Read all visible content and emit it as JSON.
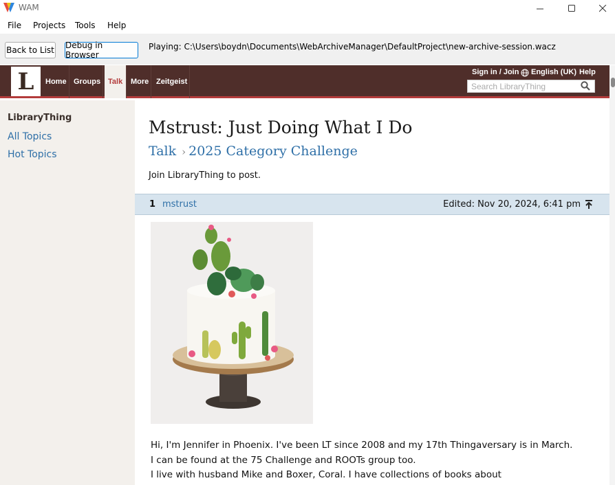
{
  "window": {
    "title": "WAM",
    "minimize_icon": "minimize-icon",
    "maximize_icon": "maximize-icon",
    "close_icon": "close-icon"
  },
  "menu": {
    "items": [
      "File",
      "Projects",
      "Tools",
      "Help"
    ]
  },
  "toolbar": {
    "back_label": "Back to List",
    "debug_label": "Debug in Browser",
    "playing_text": "Playing: C:\\Users\\boydn\\Documents\\WebArchiveManager\\DefaultProject\\new-archive-session.wacz"
  },
  "lt_header": {
    "logo_letter": "L",
    "nav": [
      "Home",
      "Groups",
      "Talk",
      "More",
      "Zeitgeist"
    ],
    "active_nav": "Talk",
    "sign_in": "Sign in / Join",
    "language": "English (UK)",
    "help": "Help",
    "search_placeholder": "Search LibraryThing",
    "colors": {
      "header_bg": "#4f2e2a",
      "accent": "#b33b3b"
    }
  },
  "sidebar": {
    "heading": "LibraryThing",
    "links": [
      "All Topics",
      "Hot Topics"
    ]
  },
  "topic": {
    "title": "Mstrust: Just Doing What I Do",
    "breadcrumb": [
      "Talk",
      "2025 Category Challenge"
    ],
    "join_text": "Join LibraryThing to post."
  },
  "post": {
    "number": "1",
    "author": "mstrust",
    "edited": "Edited: Nov 20, 2024, 6:41 pm",
    "image": "cactus-cake-photo",
    "lines": [
      "Hi, I'm Jennifer in Phoenix. I've been LT since 2008 and my 17th Thingaversary is in March.",
      "I can be found at the 75 Challenge and ROOTs group too.",
      "I live with husband Mike and Boxer, Coral. I have collections of books about"
    ]
  }
}
